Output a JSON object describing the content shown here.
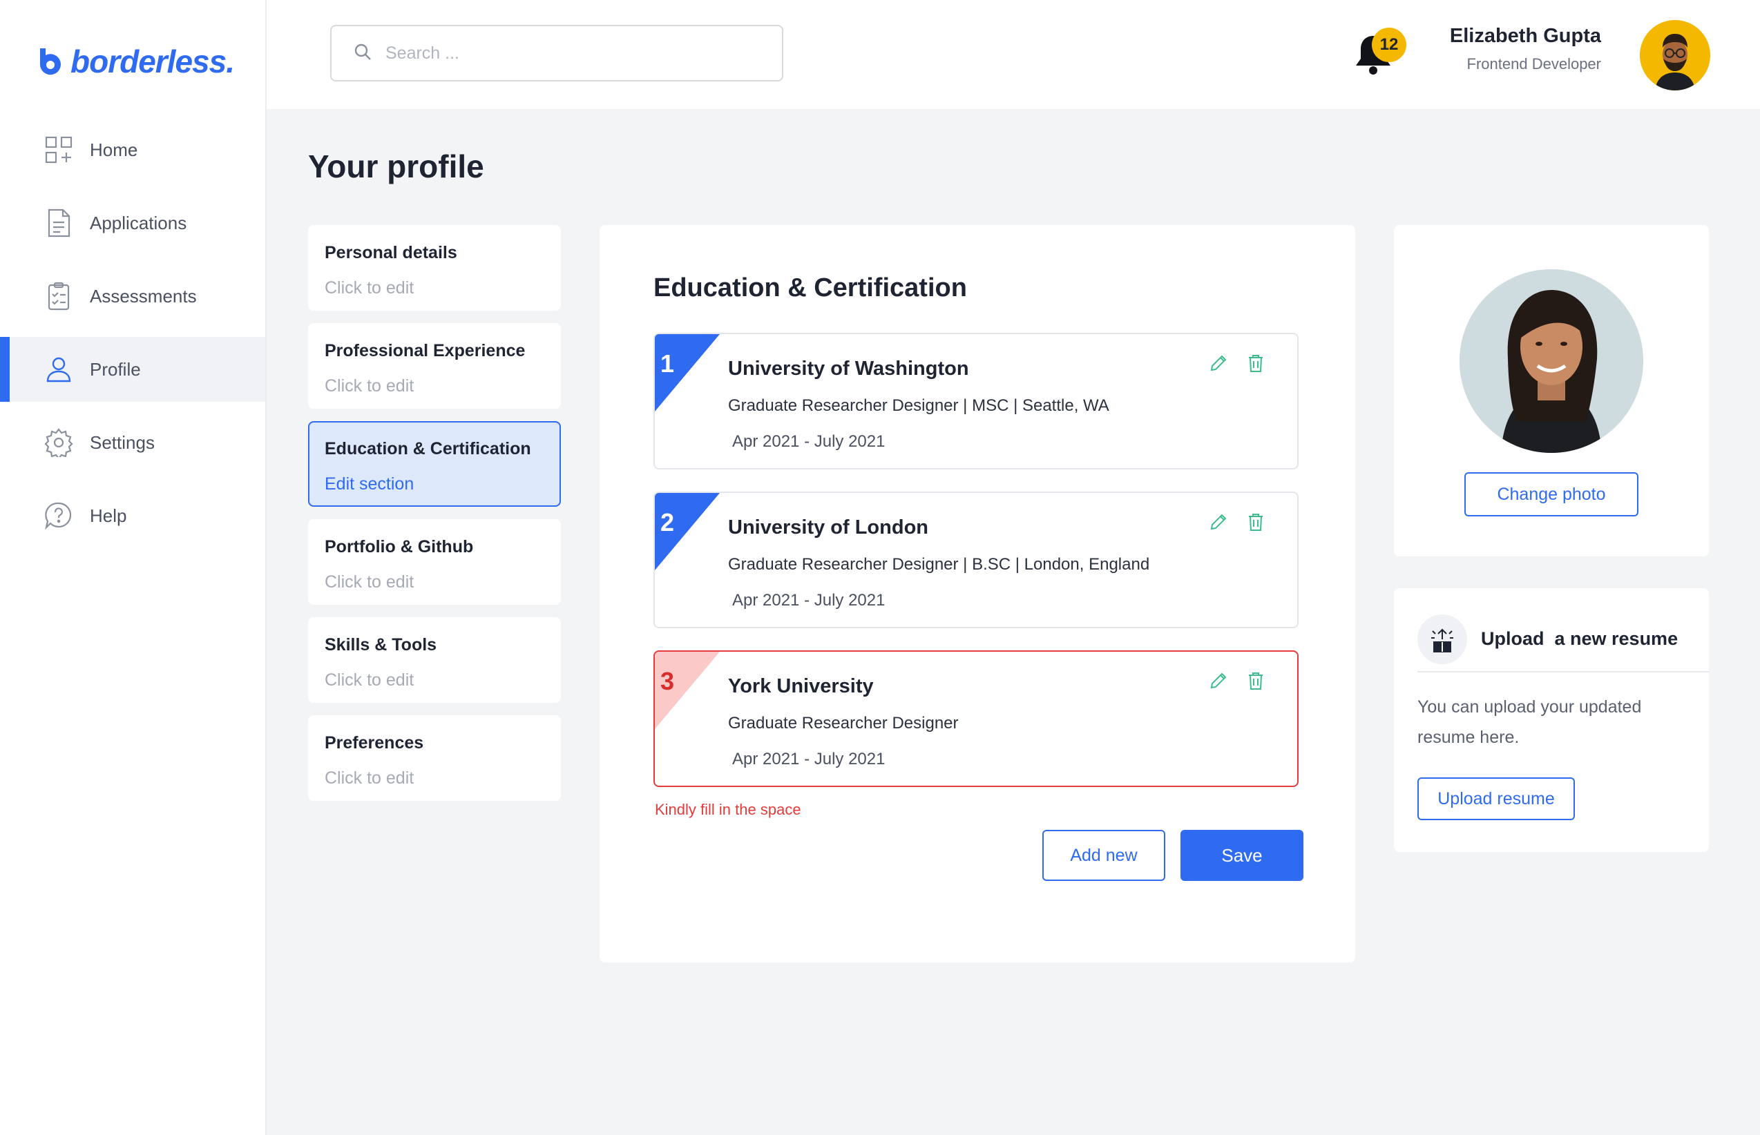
{
  "brand": {
    "name": "borderless.",
    "accent": "#2f6bf0"
  },
  "nav": [
    {
      "label": "Home",
      "icon": "home-grid-icon"
    },
    {
      "label": "Applications",
      "icon": "document-icon"
    },
    {
      "label": "Assessments",
      "icon": "clipboard-check-icon"
    },
    {
      "label": "Profile",
      "icon": "user-icon",
      "active": true
    },
    {
      "label": "Settings",
      "icon": "gear-icon"
    },
    {
      "label": "Help",
      "icon": "help-chat-icon"
    }
  ],
  "header": {
    "search_placeholder": "Search ...",
    "notification_count": "12",
    "user": {
      "name": "Elizabeth Gupta",
      "role": "Frontend Developer"
    }
  },
  "page": {
    "title": "Your profile"
  },
  "sections": [
    {
      "title": "Personal details",
      "sub": "Click to edit"
    },
    {
      "title": "Professional Experience",
      "sub": "Click to edit"
    },
    {
      "title": "Education & Certification",
      "sub": "Edit section",
      "active": true
    },
    {
      "title": "Portfolio & Github",
      "sub": "Click to edit"
    },
    {
      "title": "Skills & Tools",
      "sub": "Click to edit"
    },
    {
      "title": "Preferences",
      "sub": "Click to edit"
    }
  ],
  "education": {
    "heading": "Education & Certification",
    "entries": [
      {
        "num": "1",
        "school": "University of Washington",
        "meta": "Graduate Researcher Designer  | MSC | Seattle, WA",
        "date": "Apr 2021 - July 2021"
      },
      {
        "num": "2",
        "school": "University of London",
        "meta": "Graduate Researcher Designer  | B.SC |  London, England",
        "date": "Apr 2021 - July 2021"
      },
      {
        "num": "3",
        "school": "York University",
        "meta": "Graduate Researcher Designer",
        "date": "Apr 2021 - July 2021",
        "error": true
      }
    ],
    "error_message": "Kindly fill in the space",
    "add_label": "Add new",
    "save_label": "Save"
  },
  "photo_card": {
    "change_label": "Change photo"
  },
  "resume_card": {
    "title": "Upload  a new resume",
    "text": "You can upload your updated resume here.",
    "button_label": "Upload resume"
  },
  "colors": {
    "accent": "#2f6bf0",
    "error": "#e53b3b",
    "badge": "#f5b800",
    "edit_icon": "#3dbd8c"
  }
}
